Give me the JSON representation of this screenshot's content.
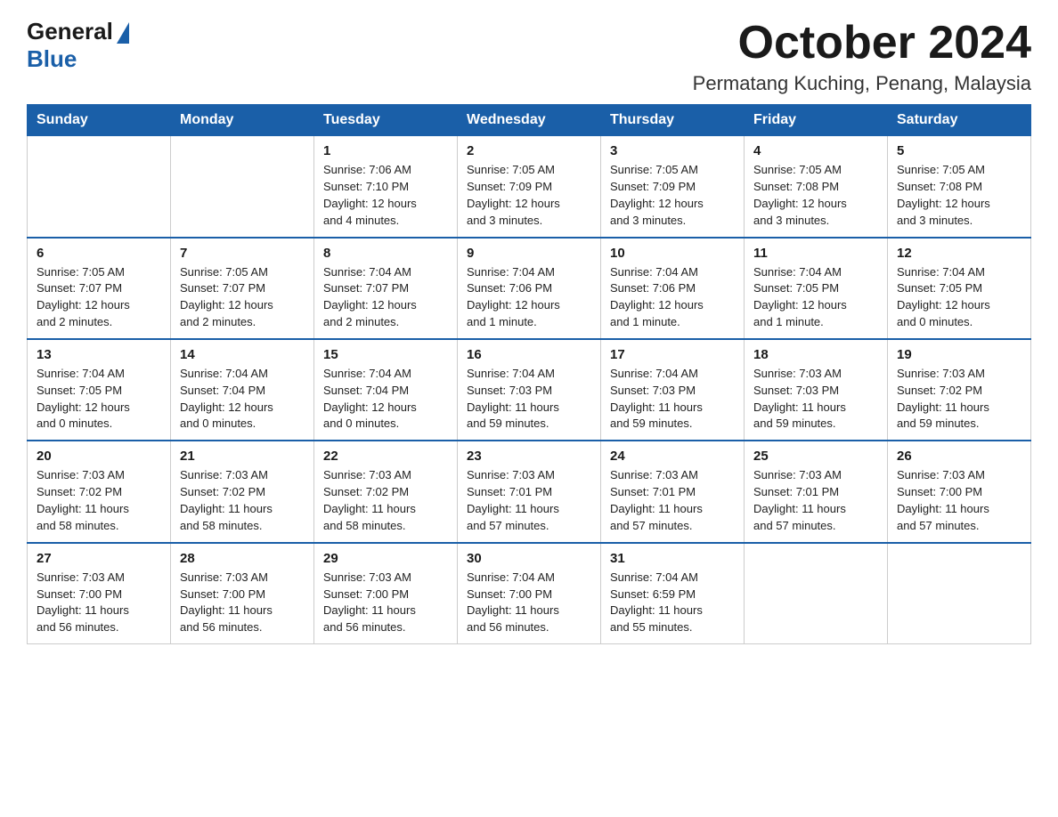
{
  "header": {
    "logo_general": "General",
    "logo_blue": "Blue",
    "month_title": "October 2024",
    "location": "Permatang Kuching, Penang, Malaysia"
  },
  "weekdays": [
    "Sunday",
    "Monday",
    "Tuesday",
    "Wednesday",
    "Thursday",
    "Friday",
    "Saturday"
  ],
  "weeks": [
    [
      {
        "day": "",
        "info": ""
      },
      {
        "day": "",
        "info": ""
      },
      {
        "day": "1",
        "info": "Sunrise: 7:06 AM\nSunset: 7:10 PM\nDaylight: 12 hours\nand 4 minutes."
      },
      {
        "day": "2",
        "info": "Sunrise: 7:05 AM\nSunset: 7:09 PM\nDaylight: 12 hours\nand 3 minutes."
      },
      {
        "day": "3",
        "info": "Sunrise: 7:05 AM\nSunset: 7:09 PM\nDaylight: 12 hours\nand 3 minutes."
      },
      {
        "day": "4",
        "info": "Sunrise: 7:05 AM\nSunset: 7:08 PM\nDaylight: 12 hours\nand 3 minutes."
      },
      {
        "day": "5",
        "info": "Sunrise: 7:05 AM\nSunset: 7:08 PM\nDaylight: 12 hours\nand 3 minutes."
      }
    ],
    [
      {
        "day": "6",
        "info": "Sunrise: 7:05 AM\nSunset: 7:07 PM\nDaylight: 12 hours\nand 2 minutes."
      },
      {
        "day": "7",
        "info": "Sunrise: 7:05 AM\nSunset: 7:07 PM\nDaylight: 12 hours\nand 2 minutes."
      },
      {
        "day": "8",
        "info": "Sunrise: 7:04 AM\nSunset: 7:07 PM\nDaylight: 12 hours\nand 2 minutes."
      },
      {
        "day": "9",
        "info": "Sunrise: 7:04 AM\nSunset: 7:06 PM\nDaylight: 12 hours\nand 1 minute."
      },
      {
        "day": "10",
        "info": "Sunrise: 7:04 AM\nSunset: 7:06 PM\nDaylight: 12 hours\nand 1 minute."
      },
      {
        "day": "11",
        "info": "Sunrise: 7:04 AM\nSunset: 7:05 PM\nDaylight: 12 hours\nand 1 minute."
      },
      {
        "day": "12",
        "info": "Sunrise: 7:04 AM\nSunset: 7:05 PM\nDaylight: 12 hours\nand 0 minutes."
      }
    ],
    [
      {
        "day": "13",
        "info": "Sunrise: 7:04 AM\nSunset: 7:05 PM\nDaylight: 12 hours\nand 0 minutes."
      },
      {
        "day": "14",
        "info": "Sunrise: 7:04 AM\nSunset: 7:04 PM\nDaylight: 12 hours\nand 0 minutes."
      },
      {
        "day": "15",
        "info": "Sunrise: 7:04 AM\nSunset: 7:04 PM\nDaylight: 12 hours\nand 0 minutes."
      },
      {
        "day": "16",
        "info": "Sunrise: 7:04 AM\nSunset: 7:03 PM\nDaylight: 11 hours\nand 59 minutes."
      },
      {
        "day": "17",
        "info": "Sunrise: 7:04 AM\nSunset: 7:03 PM\nDaylight: 11 hours\nand 59 minutes."
      },
      {
        "day": "18",
        "info": "Sunrise: 7:03 AM\nSunset: 7:03 PM\nDaylight: 11 hours\nand 59 minutes."
      },
      {
        "day": "19",
        "info": "Sunrise: 7:03 AM\nSunset: 7:02 PM\nDaylight: 11 hours\nand 59 minutes."
      }
    ],
    [
      {
        "day": "20",
        "info": "Sunrise: 7:03 AM\nSunset: 7:02 PM\nDaylight: 11 hours\nand 58 minutes."
      },
      {
        "day": "21",
        "info": "Sunrise: 7:03 AM\nSunset: 7:02 PM\nDaylight: 11 hours\nand 58 minutes."
      },
      {
        "day": "22",
        "info": "Sunrise: 7:03 AM\nSunset: 7:02 PM\nDaylight: 11 hours\nand 58 minutes."
      },
      {
        "day": "23",
        "info": "Sunrise: 7:03 AM\nSunset: 7:01 PM\nDaylight: 11 hours\nand 57 minutes."
      },
      {
        "day": "24",
        "info": "Sunrise: 7:03 AM\nSunset: 7:01 PM\nDaylight: 11 hours\nand 57 minutes."
      },
      {
        "day": "25",
        "info": "Sunrise: 7:03 AM\nSunset: 7:01 PM\nDaylight: 11 hours\nand 57 minutes."
      },
      {
        "day": "26",
        "info": "Sunrise: 7:03 AM\nSunset: 7:00 PM\nDaylight: 11 hours\nand 57 minutes."
      }
    ],
    [
      {
        "day": "27",
        "info": "Sunrise: 7:03 AM\nSunset: 7:00 PM\nDaylight: 11 hours\nand 56 minutes."
      },
      {
        "day": "28",
        "info": "Sunrise: 7:03 AM\nSunset: 7:00 PM\nDaylight: 11 hours\nand 56 minutes."
      },
      {
        "day": "29",
        "info": "Sunrise: 7:03 AM\nSunset: 7:00 PM\nDaylight: 11 hours\nand 56 minutes."
      },
      {
        "day": "30",
        "info": "Sunrise: 7:04 AM\nSunset: 7:00 PM\nDaylight: 11 hours\nand 56 minutes."
      },
      {
        "day": "31",
        "info": "Sunrise: 7:04 AM\nSunset: 6:59 PM\nDaylight: 11 hours\nand 55 minutes."
      },
      {
        "day": "",
        "info": ""
      },
      {
        "day": "",
        "info": ""
      }
    ]
  ]
}
